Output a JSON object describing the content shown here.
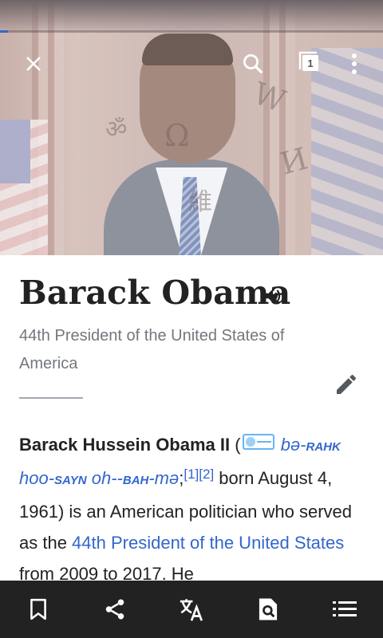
{
  "toolbar": {
    "close_icon": "close-icon",
    "search_icon": "search-icon",
    "tabs_count": "1",
    "overflow_icon": "overflow-menu-icon"
  },
  "load_progress": 0.02,
  "lead_image": {
    "subject": "portrait photo",
    "puzzle_glyphs": [
      "W",
      "Ω",
      "И",
      "維",
      "ॐ"
    ]
  },
  "article": {
    "title": "Barack Obama",
    "description": "44th President of the United States of America",
    "body": {
      "bold_name": "Barack Hussein Obama II",
      "open_paren": " (",
      "ipa_1": "bə-",
      "ipa_1_sc": "RAHK",
      "ipa_2": "hoo-",
      "ipa_2_sc": "SAYN",
      "ipa_3": " oh-",
      "ipa_3_sc": "BAH",
      "ipa_4": "-mə",
      "semi": ";",
      "ref1": "[1]",
      "ref2": "[2]",
      "text_1": " born August 4, 1961) is an American politician who served as the ",
      "link_1": "44th President of the United States",
      "text_2": " from 2009 to 2017. He"
    }
  },
  "bottom_bar": [
    "bookmark-icon",
    "share-icon",
    "translate-icon",
    "find-in-page-icon",
    "table-of-contents-icon"
  ],
  "colors": {
    "link": "#3366cc",
    "text": "#222222",
    "description": "#72777d",
    "bottom_bar": "#222222"
  }
}
